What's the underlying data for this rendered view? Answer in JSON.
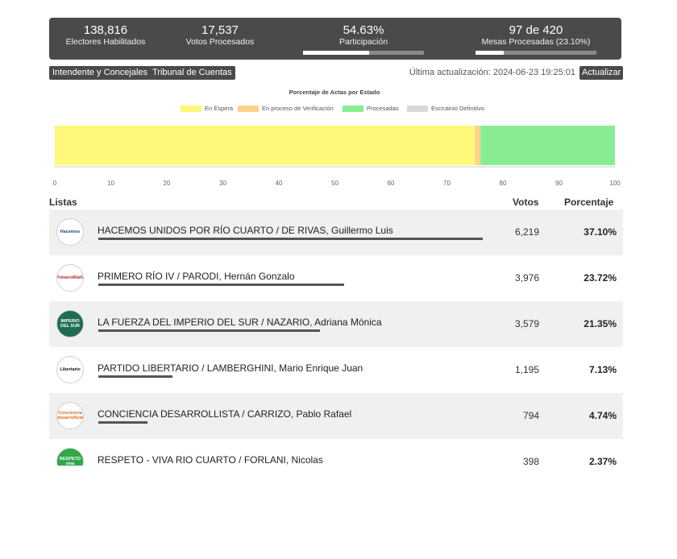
{
  "stats": {
    "electores_value": "138,816",
    "electores_label": "Electores Habilitados",
    "votos_value": "17,537",
    "votos_label": "Votos Procesados",
    "participacion_value": "54.63%",
    "participacion_label": "Participación",
    "participacion_fraction": 0.5463,
    "mesas_value": "97 de 420",
    "mesas_label": "Mesas Procesadas (23.10%)",
    "mesas_fraction": 0.231
  },
  "tabs": [
    {
      "label": "Intendente y Concejales"
    },
    {
      "label": "Tribunal de Cuentas"
    }
  ],
  "last_update": "Última actualización: 2024-06-23 19:25:01",
  "refresh_label": "Actualizar",
  "chart_data": {
    "type": "bar",
    "orientation": "horizontal-stacked",
    "title": "Porcentaje de Actas por Estado",
    "legend_position": "top",
    "series": [
      {
        "name": "En Espera",
        "color": "#fdf87a",
        "values": [
          75
        ]
      },
      {
        "name": "En proceso de Verificación",
        "color": "#fbd48a",
        "values": [
          1
        ]
      },
      {
        "name": "Procesadas",
        "color": "#88ec94",
        "values": [
          24
        ]
      },
      {
        "name": "Escrutinio Definitivo",
        "color": "#d9d9d9",
        "values": [
          0
        ]
      }
    ],
    "xlim": [
      0,
      100
    ],
    "xticks": [
      "0",
      "10",
      "20",
      "30",
      "40",
      "50",
      "60",
      "70",
      "80",
      "90",
      "100"
    ],
    "grid": false
  },
  "table": {
    "col_listas": "Listas",
    "col_votos": "Votos",
    "col_porcentaje": "Porcentaje",
    "rows": [
      {
        "name": "HACEMOS UNIDOS POR RÍO CUARTO / DE RIVAS, Guillermo Luis",
        "votes": "6,219",
        "pct": "37.10%",
        "pct_value": 37.1,
        "logo_text": "Hacemos",
        "logo_bg": "#ffffff",
        "logo_fg": "#1b3f8f"
      },
      {
        "name": "PRIMERO RÍO IV / PARODI, Hernán Gonzalo",
        "votes": "3,976",
        "pct": "23.72%",
        "pct_value": 23.72,
        "logo_text": "PrimeroRíoIV",
        "logo_bg": "#ffffff",
        "logo_fg": "#b31b1b"
      },
      {
        "name": "LA FUERZA DEL IMPERIO DEL SUR / NAZARIO, Adriana Mónica",
        "votes": "3,579",
        "pct": "21.35%",
        "pct_value": 21.35,
        "logo_text": "IMPERIO DEL SUR",
        "logo_bg": "#1f6b54",
        "logo_fg": "#ffffff"
      },
      {
        "name": "PARTIDO LIBERTARIO / LAMBERGHINI, Mario Enrique Juan",
        "votes": "1,195",
        "pct": "7.13%",
        "pct_value": 7.13,
        "logo_text": "Libertario",
        "logo_bg": "#ffffff",
        "logo_fg": "#111111"
      },
      {
        "name": "CONCIENCIA DESARROLLISTA / CARRIZO, Pablo Rafael",
        "votes": "794",
        "pct": "4.74%",
        "pct_value": 4.74,
        "logo_text": "Conciencia desarrollista",
        "logo_bg": "#ffffff",
        "logo_fg": "#e26a1c"
      },
      {
        "name": "RESPETO - VIVA RIO CUARTO / FORLANI, Nicolas",
        "votes": "398",
        "pct": "2.37%",
        "pct_value": 2.37,
        "logo_text": "RESPETO viva",
        "logo_bg": "#2ea84a",
        "logo_fg": "#ffffff"
      }
    ]
  }
}
